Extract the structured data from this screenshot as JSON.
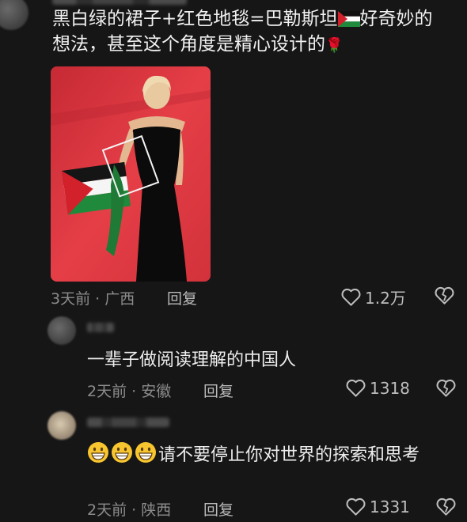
{
  "comment_main": {
    "line1_a": "黑白绿的裙子+红色地毯=巴勒斯坦",
    "line1_b": "好奇妙的",
    "line2": "想法，甚至这个角度是精心设计的",
    "time": "3天前",
    "sep": "·",
    "location": "广西",
    "reply_label": "回复",
    "likes": "1.2万",
    "flag_icon": "palestine-flag-icon",
    "rose_glyph": "🌹"
  },
  "reply1": {
    "text": "一辈子做阅读理解的中国人",
    "time": "2天前",
    "sep": "·",
    "location": "安徽",
    "reply_label": "回复",
    "likes": "1318"
  },
  "reply2": {
    "text": "请不要停止你对世界的探索和思考",
    "emoji_count": 3,
    "emoji_icon": "grinning-face-icon",
    "time": "2天前",
    "sep": "·",
    "location": "陕西",
    "reply_label": "回复",
    "likes": "1331"
  },
  "colors": {
    "background": "#161616",
    "red_carpet": "#d9343d",
    "flag_green": "#1f8a3b",
    "flag_red": "#d3212c"
  }
}
